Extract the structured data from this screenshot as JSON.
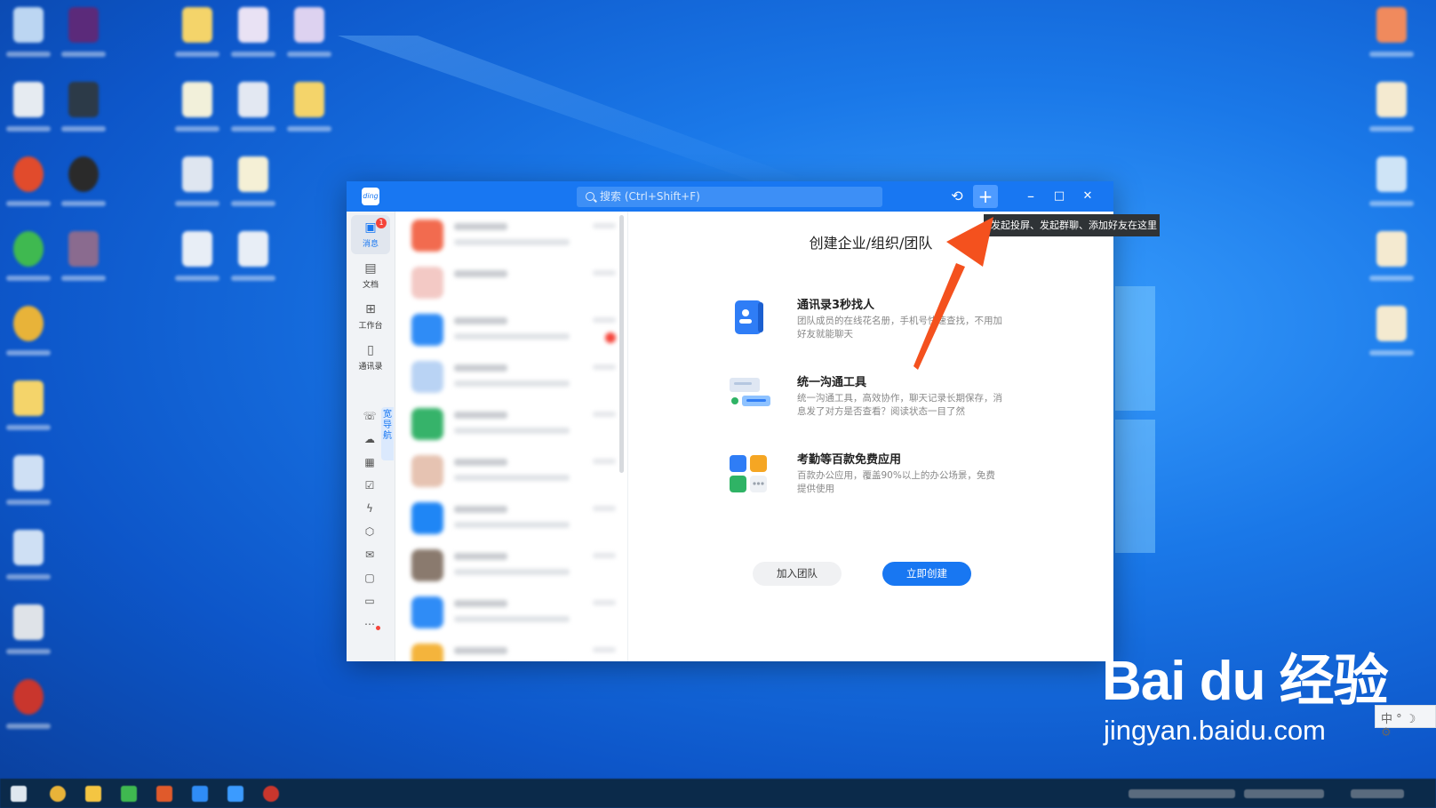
{
  "window": {
    "search_placeholder": "搜索 (Ctrl+Shift+F)",
    "plus_label": "+",
    "history_label": "⟲",
    "minimize_label": "–",
    "maximize_label": "□",
    "close_label": "✕",
    "tooltip": "发起投屏、发起群聊、添加好友在这里"
  },
  "nav": {
    "items": [
      {
        "label": "消息",
        "badge": "1"
      },
      {
        "label": "文档"
      },
      {
        "label": "工作台"
      },
      {
        "label": "通讯录"
      }
    ],
    "guide_label": "宽导航"
  },
  "main": {
    "title": "创建企业/组织/团队",
    "features": [
      {
        "title": "通讯录3秒找人",
        "desc": "团队成员的在线花名册，手机号快速查找，不用加好友就能聊天"
      },
      {
        "title": "统一沟通工具",
        "desc": "统一沟通工具，高效协作，聊天记录长期保存，消息发了对方是否查看？阅读状态一目了然"
      },
      {
        "title": "考勤等百款免费应用",
        "desc": "百款办公应用，覆盖90%以上的办公场景，免费提供使用"
      }
    ],
    "join_button": "加入团队",
    "create_button": "立即创建"
  },
  "watermark": {
    "logo": "Bai du 经验",
    "url": "jingyan.baidu.com"
  },
  "ime": "中 ° ☽ ⚙",
  "colors": {
    "accent": "#1877f2",
    "arrow": "#f4511e",
    "badge": "#f5443a"
  }
}
